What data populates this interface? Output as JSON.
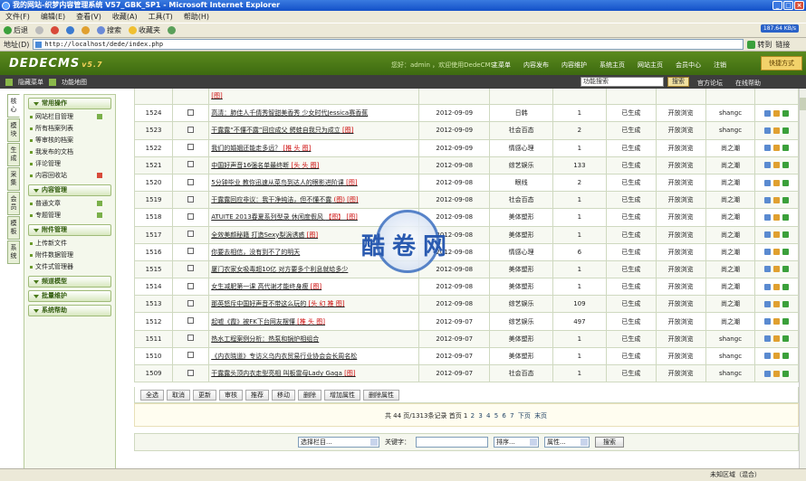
{
  "window": {
    "title": "我的网站-织梦内容管理系统 V57_GBK_SP1 - Microsoft Internet Explorer"
  },
  "menubar": [
    "文件(F)",
    "编辑(E)",
    "查看(V)",
    "收藏(A)",
    "工具(T)",
    "帮助(H)"
  ],
  "toolbar": {
    "back": "后退",
    "search": "搜索",
    "favorites": "收藏夹",
    "speed": "187.64 KB/s"
  },
  "address": {
    "label": "地址(D)",
    "url": "http://localhost/dede/index.php",
    "go": "转到",
    "links": "链接"
  },
  "header": {
    "logo": "DEDECMS",
    "version": "v5.7",
    "user_text": "您好：admin ，欢迎使用DedeCMS！",
    "nav": [
      "主菜单",
      "内容发布",
      "内容维护",
      "系统主页",
      "网站主页",
      "会员中心",
      "注销"
    ],
    "quick": "快捷方式"
  },
  "subheader": {
    "hide_menu": "隐藏菜单",
    "map": "功能地图",
    "search_placeholder": "功能搜索",
    "search_btn": "搜索",
    "forum": "官方论坛",
    "help": "在线帮助"
  },
  "left_tabs": [
    "核心",
    "模块",
    "生成",
    "采集",
    "会员",
    "模板",
    "系统"
  ],
  "sidebar": {
    "sections": [
      {
        "title": "常用操作",
        "items": [
          "网站栏目管理",
          "所有档案列表",
          "等审核的档案",
          "我发布的文档",
          "评论管理",
          "内容回收站"
        ]
      },
      {
        "title": "内容管理",
        "items": [
          "普通文章",
          "专题管理"
        ]
      },
      {
        "title": "附件管理",
        "items": [
          "上传新文件",
          "附件数据管理",
          "文件式管理器"
        ]
      },
      {
        "title": "频道模型",
        "items": []
      },
      {
        "title": "批量维护",
        "items": []
      },
      {
        "title": "系统帮助",
        "items": []
      }
    ]
  },
  "table": {
    "rows": [
      {
        "id": "",
        "title": "",
        "tag": "[图]",
        "date": "",
        "cat": "",
        "clicks": "",
        "status": "",
        "mode": "",
        "author": ""
      },
      {
        "id": "1524",
        "title": "高清：肺佳人千倩秀智甜美香秀 少女时代Jessica赛香蕉",
        "tag": "",
        "date": "2012-09-09",
        "cat": "日韩",
        "clicks": "1",
        "status": "已生成",
        "mode": "开放浏览",
        "author": "shangc"
      },
      {
        "id": "1523",
        "title": "干露露“不懂不露”回应成父 鳄蛙自我只为成立",
        "tag": "[图]",
        "date": "2012-09-09",
        "cat": "社会百态",
        "clicks": "2",
        "status": "已生成",
        "mode": "开放浏览",
        "author": "shangc"
      },
      {
        "id": "1522",
        "title": "我们的婚姻还能走多远？",
        "tag": "[推 头 图]",
        "date": "2012-09-09",
        "cat": "情感心理",
        "clicks": "1",
        "status": "已生成",
        "mode": "开放浏览",
        "author": "尚之潮"
      },
      {
        "id": "1521",
        "title": "中国好声音16强名单最终断",
        "tag": "[头 头 图]",
        "date": "2012-09-08",
        "cat": "综艺娱乐",
        "clicks": "133",
        "status": "已生成",
        "mode": "开放浏览",
        "author": "尚之潮"
      },
      {
        "id": "1520",
        "title": "5分钟毕业 教你迅速从菜鸟到达人的眼影进阶课",
        "tag": "[图]",
        "date": "2012-09-08",
        "cat": "眼线",
        "clicks": "2",
        "status": "已生成",
        "mode": "开放浏览",
        "author": "尚之潮"
      },
      {
        "id": "1519",
        "title": "干露露回应非议：我干净纯洁，但不懂不露",
        "tag": "(图) [图]",
        "date": "2012-09-08",
        "cat": "社会百态",
        "clicks": "1",
        "status": "已生成",
        "mode": "开放浏览",
        "author": "尚之潮"
      },
      {
        "id": "1518",
        "title": "ATUITE 2013春夏系列型录 休闲度假风",
        "tag": "【图】 [图]",
        "date": "2012-09-08",
        "cat": "美体塑形",
        "clicks": "1",
        "status": "已生成",
        "mode": "开放浏览",
        "author": "尚之潮"
      },
      {
        "id": "1517",
        "title": "全效美颜秘籍 打造Sexy梨涡诱惑",
        "tag": "[图]",
        "date": "2012-09-08",
        "cat": "美体塑形",
        "clicks": "1",
        "status": "已生成",
        "mode": "开放浏览",
        "author": "尚之潮"
      },
      {
        "id": "1516",
        "title": "你要去相信，没有到不了的明天",
        "tag": "",
        "date": "2012-09-08",
        "cat": "情感心理",
        "clicks": "6",
        "status": "已生成",
        "mode": "开放浏览",
        "author": "尚之潮"
      },
      {
        "id": "1515",
        "title": "厦门农家女吸毒超10亿 对方要多个利息就给多少",
        "tag": "",
        "date": "2012-09-08",
        "cat": "美体塑形",
        "clicks": "1",
        "status": "已生成",
        "mode": "开放浏览",
        "author": "尚之潮"
      },
      {
        "id": "1514",
        "title": "女生减肥第一课 高代谢才能终身瘦",
        "tag": "[图]",
        "date": "2012-09-08",
        "cat": "美体塑形",
        "clicks": "1",
        "status": "已生成",
        "mode": "开放浏览",
        "author": "尚之潮"
      },
      {
        "id": "1513",
        "title": "那英怒斥中国好声音不带这么玩的",
        "tag": "[头 幻 推 图]",
        "date": "2012-09-08",
        "cat": "综艺娱乐",
        "clicks": "109",
        "status": "已生成",
        "mode": "开放浏览",
        "author": "尚之潮"
      },
      {
        "id": "1512",
        "title": "起嘘《霞》被FK下台网友摆懂",
        "tag": "[推 头 图]",
        "date": "2012-09-07",
        "cat": "综艺娱乐",
        "clicks": "497",
        "status": "已生成",
        "mode": "开放浏览",
        "author": "尚之潮"
      },
      {
        "id": "1511",
        "title": "热水工程案例分析：热泵和锅炉相组合",
        "tag": "",
        "date": "2012-09-07",
        "cat": "美体塑形",
        "clicks": "1",
        "status": "已生成",
        "mode": "开放浏览",
        "author": "shangc"
      },
      {
        "id": "1510",
        "title": "《内衣晓道》专访义乌内衣贸易行业协会会长周名松",
        "tag": "",
        "date": "2012-09-07",
        "cat": "美体塑形",
        "clicks": "1",
        "status": "已生成",
        "mode": "开放浏览",
        "author": "shangc"
      },
      {
        "id": "1509",
        "title": "干露露头顶内衣走型亮相 叫板雷母Lady Gaga",
        "tag": "[图]",
        "date": "2012-09-07",
        "cat": "社会百态",
        "clicks": "1",
        "status": "已生成",
        "mode": "开放浏览",
        "author": "shangc"
      }
    ],
    "actions": [
      "全选",
      "取消",
      "更新",
      "审核",
      "推荐",
      "移动",
      "删除",
      "增加属性",
      "删除属性"
    ]
  },
  "pager": {
    "text": "共 44 页/1313条记录 首页 1",
    "pages": [
      "2",
      "3",
      "4",
      "5",
      "6",
      "7"
    ],
    "next": "下页",
    "last": "末页"
  },
  "searchbar": {
    "category": "选择栏目...",
    "keyword_label": "关键字：",
    "order": "排序...",
    "attr": "属性...",
    "btn": "搜索"
  },
  "status": {
    "left": "",
    "right": "未知区域（混合）"
  },
  "watermark": "酷卷网",
  "colors": {
    "header": "#4a7a18",
    "accent": "#c00000"
  }
}
